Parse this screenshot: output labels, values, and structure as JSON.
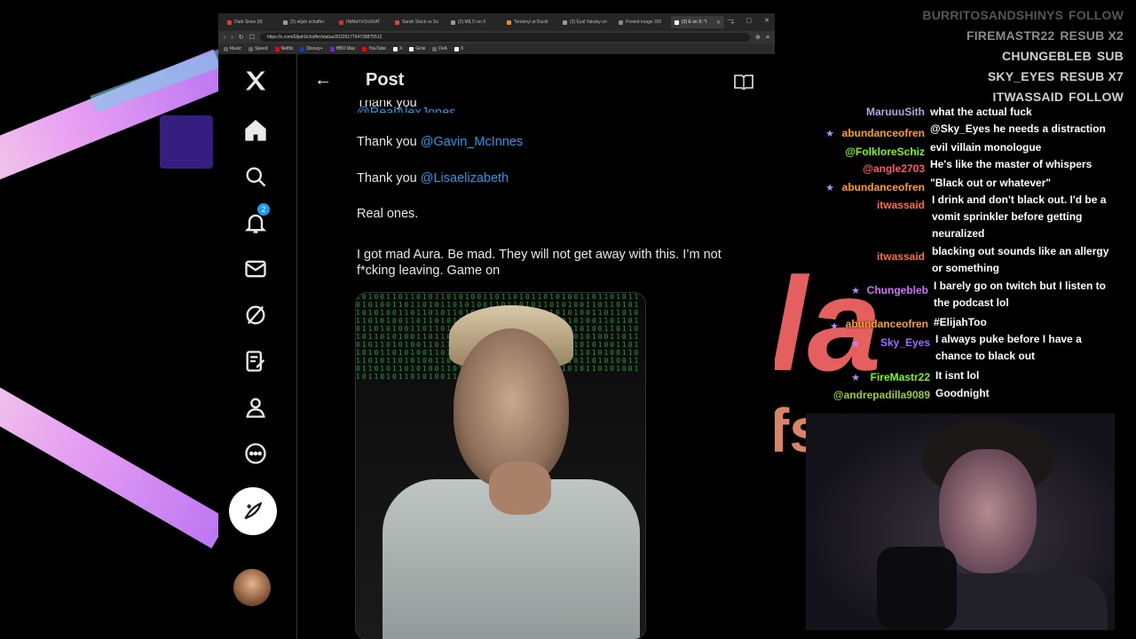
{
  "browser": {
    "tabs": [
      {
        "label": "Dark Skies (8)",
        "active": false
      },
      {
        "label": "(2) elijah schaffer",
        "active": false
      },
      {
        "label": "HbMaYnOn9XAT",
        "active": false
      },
      {
        "label": "Sarah Stock vs So",
        "active": false
      },
      {
        "label": "(2) MILO on X",
        "active": false
      },
      {
        "label": "Tenderyl at Duckt",
        "active": false
      },
      {
        "label": "(2) Eyal Yakoby on",
        "active": false
      },
      {
        "label": "Posted image 202",
        "active": false
      },
      {
        "label": "(2) E on X: \"I",
        "active": true
      }
    ],
    "new_tab": "+",
    "url": "https://x.com/ElijahSchaffer/status/2010517764738875512",
    "bookmarks": [
      "Music",
      "Speed",
      "Netflix",
      "Disney+",
      "HBO Max",
      "YouTube",
      "X",
      "Grok",
      "DeA",
      "X"
    ]
  },
  "x": {
    "page_title": "Post",
    "notification_count": "2",
    "partial_line": {
      "text": "Thank you ",
      "mention": "@RealAlexJones"
    },
    "lines": [
      {
        "text": "Thank you ",
        "mention": "@Gavin_McInnes"
      },
      {
        "text": "Thank you ",
        "mention": "@Lisaelizabeth"
      }
    ],
    "real_ones": "Real ones.",
    "body_line1": "I got mad Aura. Be mad. They will not get away with this. I’m not",
    "body_line2": "f*cking leaving. Game on",
    "matrix_text": "1010011011010110101001101101011010100110110101101010011011010110101001101101011010100110110101101010011011010110101001101101011010100110110101101010011011010110101001101101011010100110110101101010011011010110101001101101011010100110110101101010011011010110101001101101011010100110110101101010011011010110101001101101011010100110110101101010011011010110101001101101011010100110110101101010011011010110101001101101011010100110110101101010011011010110101001101101011010100110110101101010011011010110"
  },
  "overlay": {
    "alerts": [
      {
        "user": "BURRITOSANDSHINYS",
        "event": "FOLLOW",
        "style": "dim"
      },
      {
        "user": "FIREMASTR22",
        "event": "RESUB X2",
        "style": "mid"
      },
      {
        "user": "CHUNGEBLEB",
        "event": "SUB",
        "style": "normal"
      },
      {
        "user": "SKY_EYES",
        "event": "RESUB X7",
        "style": "normal"
      },
      {
        "user": "ITWASSAID",
        "event": "FOLLOW",
        "style": "highlight"
      }
    ],
    "chat": [
      {
        "user": "MaruuuSith",
        "color": "#b9a3e3",
        "text": "what the actual fuck",
        "badge": false
      },
      {
        "user": "abundanceofren",
        "color": "#ff9f1a",
        "text": "@Sky_Eyes he needs a distraction",
        "badge": true
      },
      {
        "user": "@FolkloreSchiz",
        "color": "#7cfc00",
        "text": "evil villain monologue",
        "badge": false
      },
      {
        "user": "@angle2703",
        "color": "#ff5a5a",
        "text": "He's like the master of whispers",
        "badge": false
      },
      {
        "user": "abundanceofren",
        "color": "#ff9f1a",
        "text": "\"Black out or whatever\"",
        "badge": true
      },
      {
        "user": "itwassaid",
        "color": "#ff6d3a",
        "text": "I drink and don't black out. I'd be a vomit sprinkler before getting neuralized",
        "badge": false
      },
      {
        "user": "itwassaid",
        "color": "#ff6d3a",
        "text": "blacking out sounds like an allergy or something",
        "badge": false
      },
      {
        "user": "Chungebleb",
        "color": "#d66bff",
        "text": "I barely go on twitch but I listen to the podcast lol",
        "badge": true
      },
      {
        "user": "abundanceofren",
        "color": "#ff9f1a",
        "text": "#ElijahToo",
        "badge": true
      },
      {
        "user": "Sky_Eyes",
        "color": "#9b6bff",
        "text": "I always puke before I have a chance to black out",
        "badge": true
      },
      {
        "user": "FireMastr22",
        "color": "#7cfc00",
        "text": "It isnt lol",
        "badge": true
      },
      {
        "user": "@andrepadilla9089",
        "color": "#9acd32",
        "text": "Goodnight",
        "badge": false
      }
    ]
  },
  "background": {
    "big_letters": "la",
    "big_letters2": "fs."
  }
}
